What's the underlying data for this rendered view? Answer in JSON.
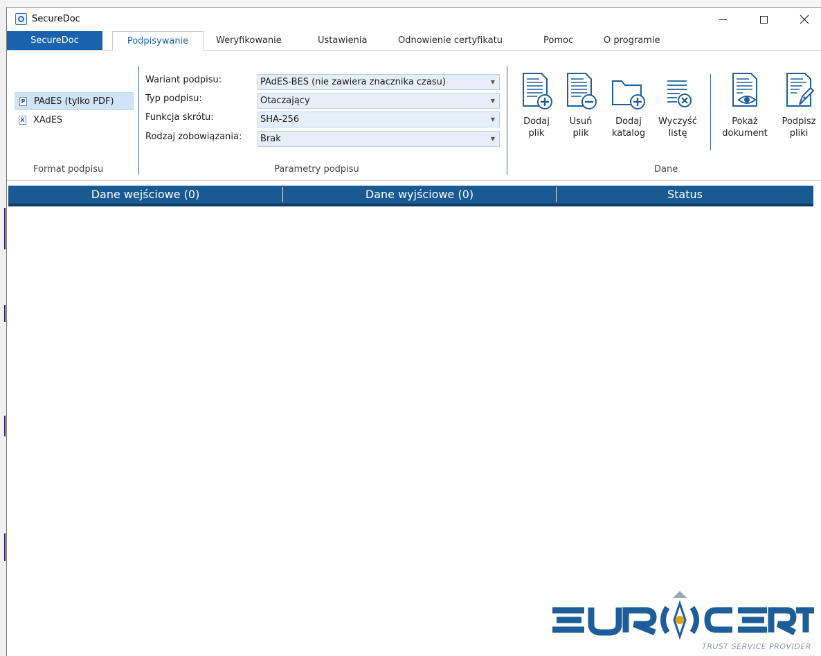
{
  "window": {
    "title": "SecureDoc",
    "controls": {
      "minimize": "minimize-icon",
      "maximize": "maximize-icon",
      "close": "close-icon"
    }
  },
  "tabs": [
    {
      "label": "SecureDoc"
    },
    {
      "label": "Podpisywanie"
    },
    {
      "label": "Weryfikowanie"
    },
    {
      "label": "Ustawienia"
    },
    {
      "label": "Odnowienie certyfikatu"
    },
    {
      "label": "Pomoc"
    },
    {
      "label": "O programie"
    }
  ],
  "ribbon": {
    "format": {
      "group_label": "Format podpisu",
      "items": [
        {
          "label": "PAdES (tylko PDF)",
          "icon": "P",
          "selected": true
        },
        {
          "label": "XAdES",
          "icon": "X",
          "selected": false
        }
      ]
    },
    "params": {
      "group_label": "Parametry podpisu",
      "rows": [
        {
          "label": "Wariant podpisu:",
          "value": "PAdES-BES (nie zawiera znacznika czasu)"
        },
        {
          "label": "Typ podpisu:",
          "value": "Otaczający"
        },
        {
          "label": "Funkcja skrótu:",
          "value": "SHA-256"
        },
        {
          "label": "Rodzaj zobowiązania:",
          "value": "Brak"
        }
      ]
    },
    "data": {
      "group_label": "Dane",
      "buttons": [
        {
          "line1": "Dodaj",
          "line2": "plik",
          "icon": "add-file-icon"
        },
        {
          "line1": "Usuń",
          "line2": "plik",
          "icon": "remove-file-icon"
        },
        {
          "line1": "Dodaj",
          "line2": "katalog",
          "icon": "add-folder-icon"
        },
        {
          "line1": "Wyczyść",
          "line2": "listę",
          "icon": "clear-list-icon"
        }
      ],
      "extra_buttons": [
        {
          "line1": "Pokaż",
          "line2": "dokument",
          "icon": "show-document-icon"
        },
        {
          "line1": "Podpisz",
          "line2": "pliki",
          "icon": "sign-files-icon"
        }
      ]
    }
  },
  "list": {
    "columns": [
      "Dane wejściowe (0)",
      "Dane wyjściowe (0)",
      "Status"
    ]
  },
  "logo": {
    "text": "EUROCERT",
    "tagline": "TRUST SERVICE PROVIDER",
    "color": "#1d5d99"
  },
  "colors": {
    "accent": "#1a62ad",
    "header": "#1a5a92",
    "combo_bg": "#e6eff9",
    "selection": "#cfe4f7"
  }
}
